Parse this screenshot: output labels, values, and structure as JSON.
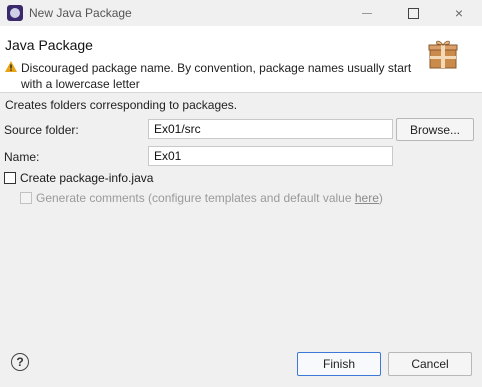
{
  "window": {
    "title": "New Java Package",
    "controls": {
      "minimize": "minimize",
      "maximize": "maximize",
      "close": "×"
    }
  },
  "banner": {
    "title": "Java Package",
    "warning": "Discouraged package name. By convention, package names usually start with a lowercase letter",
    "icon": "package-icon"
  },
  "description": "Creates folders corresponding to packages.",
  "form": {
    "source_folder_label": "Source folder:",
    "source_folder_value": "Ex01/src",
    "browse_label": "Browse...",
    "name_label": "Name:",
    "name_value": "Ex01",
    "create_info_label": "Create package-info.java",
    "create_info_checked": false,
    "generate_comments_prefix": "Generate comments (configure templates and default value ",
    "generate_comments_link": "here",
    "generate_comments_suffix": ")",
    "generate_comments_enabled": false
  },
  "footer": {
    "help_glyph": "?",
    "finish_label": "Finish",
    "cancel_label": "Cancel"
  },
  "colors": {
    "warning": "#e8a317",
    "finish_border": "#3c78d8",
    "package_icon": "#c98a4a"
  }
}
